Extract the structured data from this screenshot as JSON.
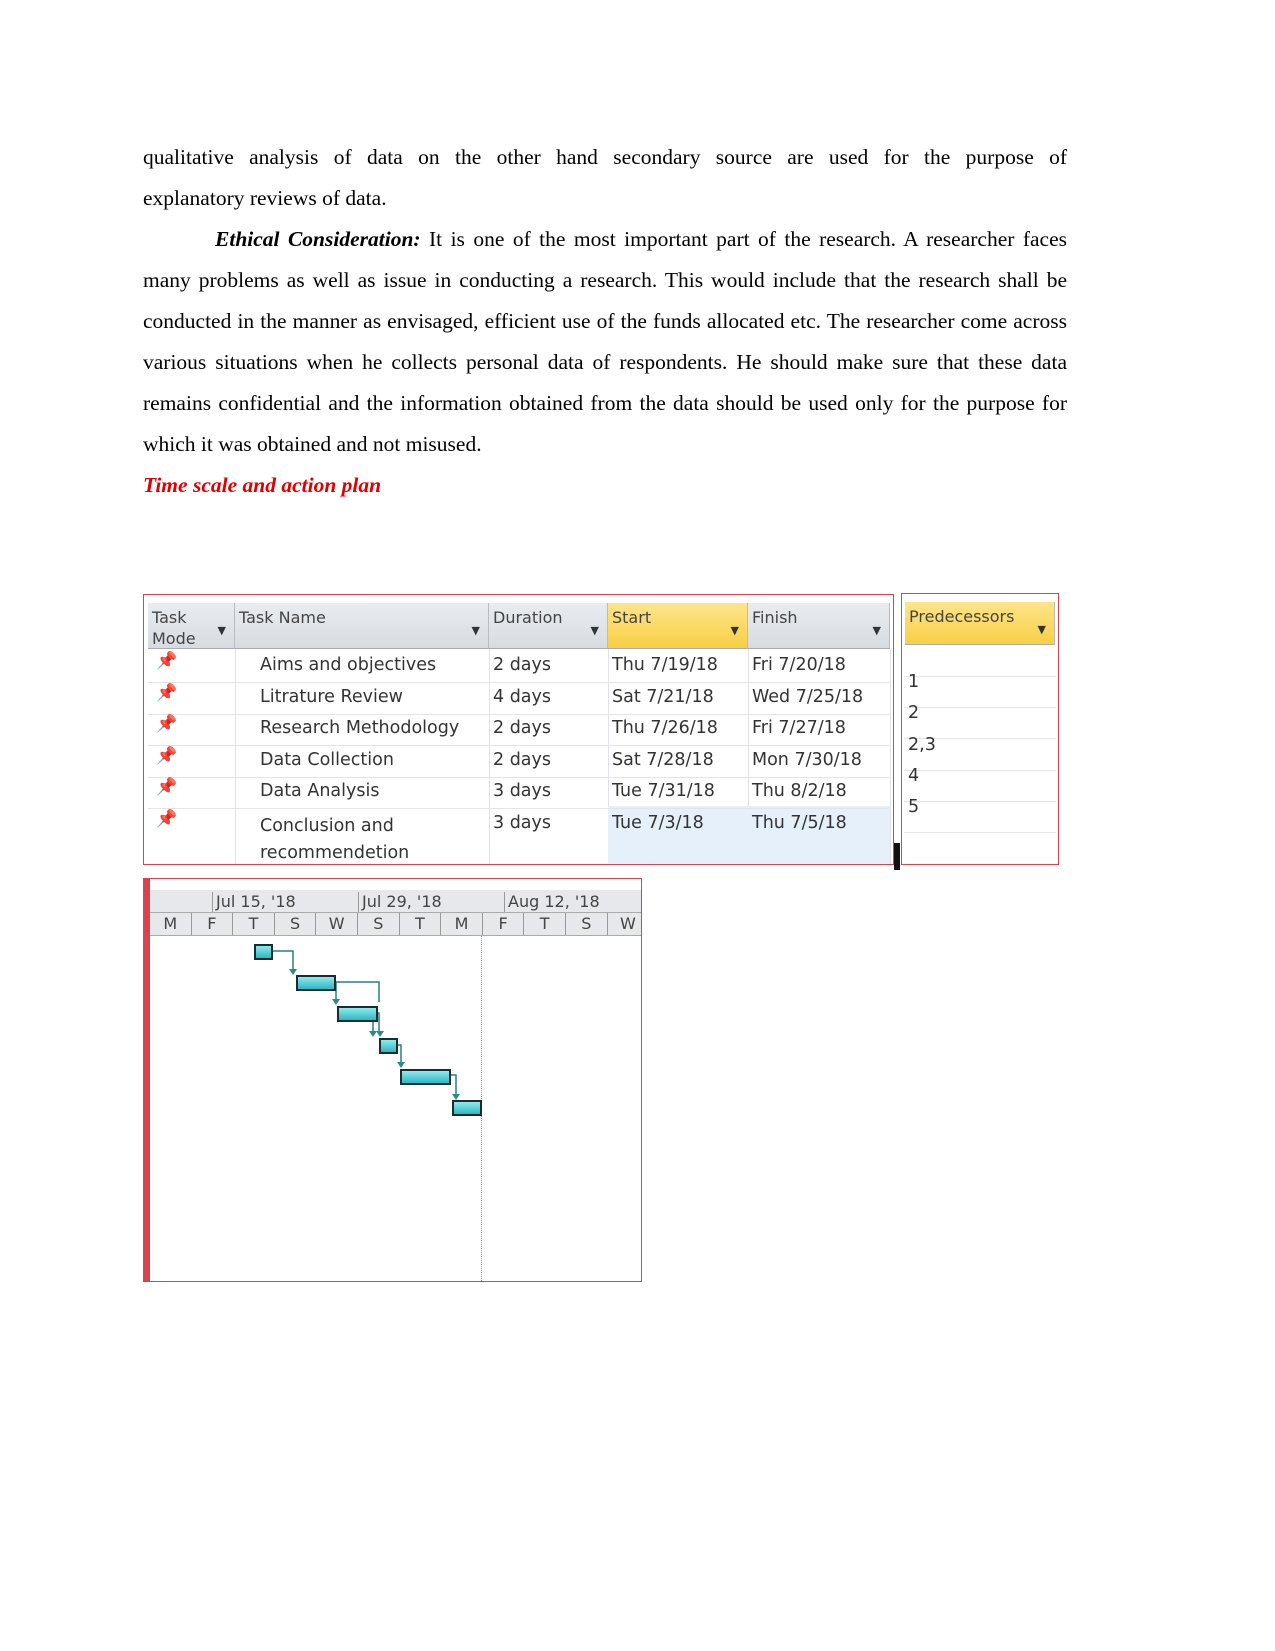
{
  "body": {
    "line1": "qualitative analysis of data on the other hand secondary source are used for the purpose of",
    "line2": "explanatory reviews of data.",
    "ethical_label": "Ethical Consideration:",
    "ethical_text": " It is one of the most important part of the research. A researcher faces many problems as well as issue in conducting a research. This would include that the research shall be conducted in the manner as envisaged, efficient use of the funds allocated etc. The researcher come across various situations when he collects personal data of respondents. He should make sure that these data remains confidential and the information obtained from the data should be used only for the purpose for which it was obtained and not misused.",
    "heading": "Time scale and action plan"
  },
  "table": {
    "columns": [
      "Task Mode",
      "Task Name",
      "Duration",
      "Start",
      "Finish"
    ],
    "pred_header": "Predecessors",
    "rows": [
      {
        "name": "Aims and objectives",
        "duration": "2 days",
        "start": "Thu 7/19/18",
        "finish": "Fri 7/20/18",
        "pred": ""
      },
      {
        "name": "Litrature Review",
        "duration": "4 days",
        "start": "Sat 7/21/18",
        "finish": "Wed 7/25/18",
        "pred": "1"
      },
      {
        "name": "Research Methodology",
        "duration": "2 days",
        "start": "Thu 7/26/18",
        "finish": "Fri 7/27/18",
        "pred": "2"
      },
      {
        "name": "Data Collection",
        "duration": "2 days",
        "start": "Sat 7/28/18",
        "finish": "Mon 7/30/18",
        "pred": "2,3"
      },
      {
        "name": "Data Analysis",
        "duration": "3 days",
        "start": "Tue 7/31/18",
        "finish": "Thu 8/2/18",
        "pred": "4"
      },
      {
        "name": "Conclusion and recommendetion",
        "duration": "3 days",
        "start": "Tue 7/3/18",
        "finish": "Thu 7/5/18",
        "pred": "5"
      }
    ],
    "task_mode_icon": "pushpin-icon",
    "header_highlight": "#f8cf44"
  },
  "gantt": {
    "months": [
      "Jul 15, '18",
      "Jul 29, '18",
      "Aug 12, '18"
    ],
    "days": [
      "M",
      "F",
      "T",
      "S",
      "W",
      "S",
      "T",
      "M",
      "F",
      "T",
      "S",
      "W"
    ],
    "bar_color": "#2fb7c2"
  }
}
